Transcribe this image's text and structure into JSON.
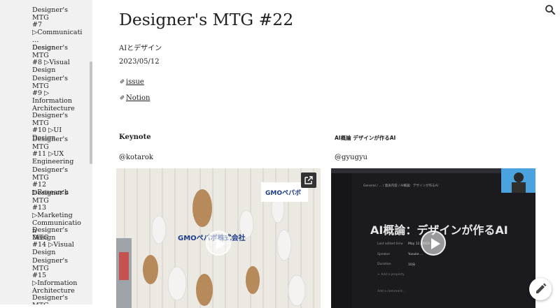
{
  "sidebar": {
    "items": [
      "Designer's MTG\n#7\n▷Communicati…\nDesign",
      "Designer's MTG\n#8 ▷Visual\nDesign",
      "Designer's MTG\n#9 ▷\nInformation\nArchitecture",
      "Designer's MTG\n#10 ▷UI Design",
      "Designer's MTG\n#11 ▷UX\nEngineering",
      "Designer's MTG\n#12 ▷Research",
      "Designer's MTG\n#13 ▷Marketing\nCommunication\nDesign",
      "Designer's MTG\n#14 ▷Visual\nDesign",
      "Designer's MTG\n#15\n▷Information\nArchitecture",
      "Designer's MTG"
    ]
  },
  "page": {
    "title": "Designer's MTG #22",
    "subtitle": "AIとデザイン",
    "date": "2023/05/12",
    "links": [
      {
        "icon": "link-icon",
        "label": "issue"
      },
      {
        "icon": "link-icon",
        "label": "Notion"
      }
    ]
  },
  "sections": {
    "left": {
      "heading": "Keynote",
      "author": "@kotarok",
      "video_logo": "GMOペパボ",
      "video_sign": "GMOペパボ株式会社"
    },
    "right": {
      "heading": "AI概論 デザインが作るAI",
      "author": "@gyugyu",
      "video_title": "AI概論：デザインが作るAI",
      "video_breadcrumb": "General / ... / 発表内容 / AI概論：デザインが作るAI",
      "video_props": [
        {
          "label": "Last edited time",
          "value": "May 12, 2023 ..."
        },
        {
          "label": "Speaker",
          "value": "Yusuke ..."
        },
        {
          "label": "Duration",
          "value": "10分"
        }
      ],
      "video_add_property": "+ Add a property",
      "video_add_comment": "Add a comment..."
    }
  },
  "icons": {
    "search": "search-icon",
    "edit": "pencil-icon",
    "open": "open-in-new-icon",
    "play": "play-icon"
  }
}
